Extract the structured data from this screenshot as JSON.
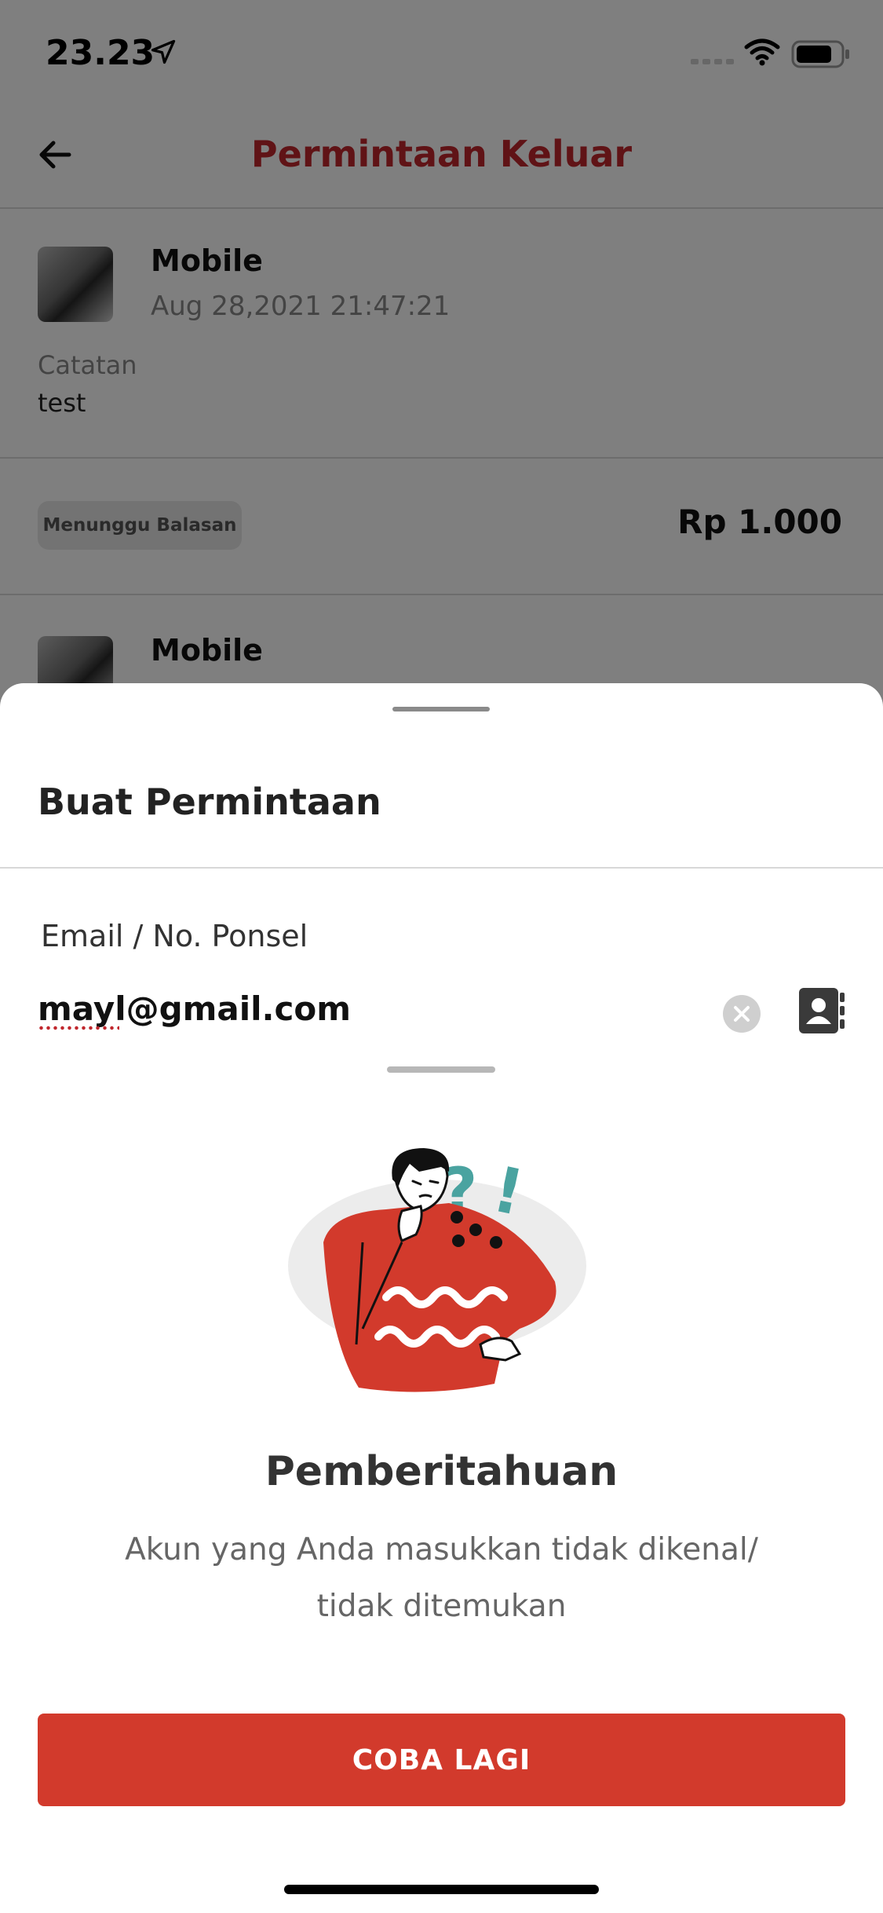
{
  "status_bar": {
    "time": "23.23",
    "icons": [
      "location-arrow-icon",
      "signal-icon",
      "wifi-icon",
      "battery-icon"
    ]
  },
  "header": {
    "title": "Permintaan Keluar",
    "back_icon": "arrow-left-icon"
  },
  "transactions": [
    {
      "name": "Mobile",
      "date": "Aug 28,2021 21:47:21",
      "note_label": "Catatan",
      "note": "test",
      "status": "Menunggu Balasan",
      "amount": "Rp 1.000"
    },
    {
      "name": "Mobile"
    }
  ],
  "request_sheet": {
    "title": "Buat Permintaan",
    "field_label": "Email / No. Ponsel",
    "field_value": "mayl@gmail.com",
    "icons": [
      "clear-icon",
      "contact-book-icon"
    ]
  },
  "notification": {
    "title": "Pemberitahuan",
    "message": "Akun yang Anda masukkan tidak dikenal/ tidak ditemukan",
    "button_label": "COBA LAGI"
  },
  "colors": {
    "brand_red": "#c0272d",
    "button_red": "#d23a2c",
    "overlay": "rgba(0,0,0,0.5)"
  }
}
